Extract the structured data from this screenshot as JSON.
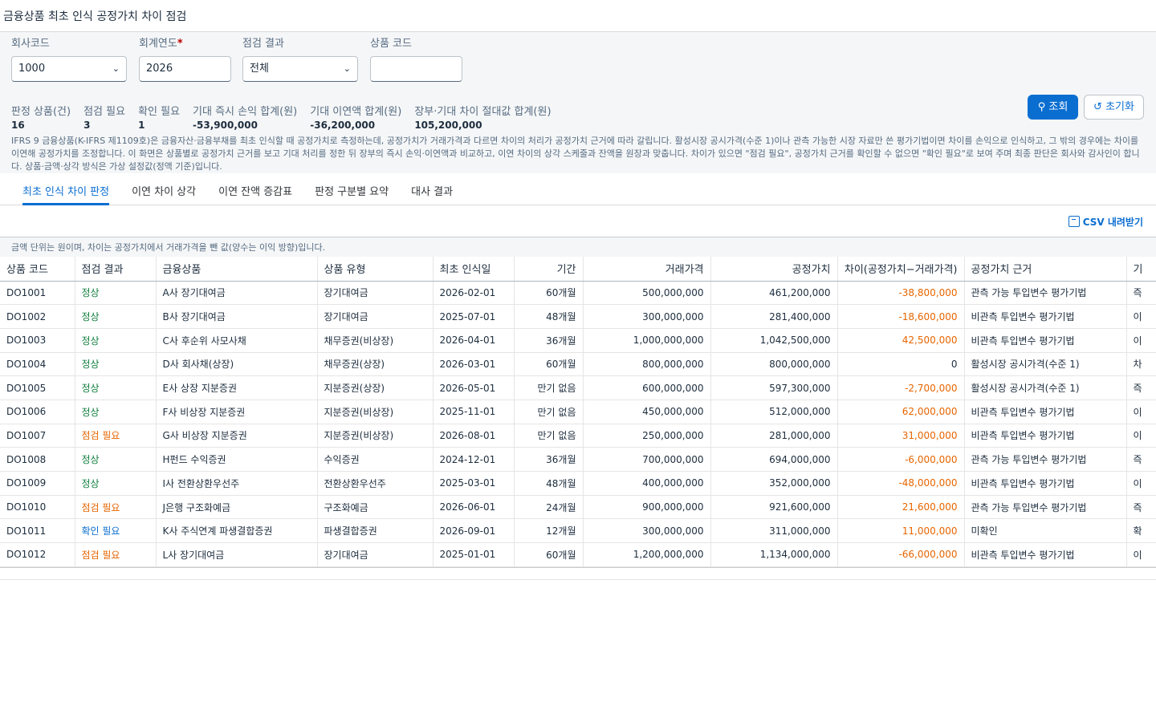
{
  "page": {
    "title": "금융상품 최초 인식 공정가치 차이 점검"
  },
  "filters": {
    "company": {
      "label": "회사코드",
      "value": "1000"
    },
    "year": {
      "label": "회계연도",
      "required_mark": "*",
      "value": "2026"
    },
    "result": {
      "label": "점검 결과",
      "value": "전체"
    },
    "product": {
      "label": "상품 코드",
      "value": ""
    },
    "search_label": "조회",
    "reset_label": "초기화"
  },
  "kpis": [
    {
      "label": "판정 상품(건)",
      "value": "16"
    },
    {
      "label": "점검 필요",
      "value": "3"
    },
    {
      "label": "확인 필요",
      "value": "1"
    },
    {
      "label": "기대 즉시 손익 합계(원)",
      "value": "-53,900,000"
    },
    {
      "label": "기대 이연액 합계(원)",
      "value": "-36,200,000"
    },
    {
      "label": "장부·기대 차이 절대값 합계(원)",
      "value": "105,200,000"
    }
  ],
  "description": "IFRS 9 금융상품(K-IFRS 제1109호)은 금융자산·금융부채를 최초 인식할 때 공정가치로 측정하는데, 공정가치가 거래가격과 다르면 차이의 처리가 공정가치 근거에 따라 갈립니다. 활성시장 공시가격(수준 1)이나 관측 가능한 시장 자료만 쓴 평가기법이면 차이를 손익으로 인식하고, 그 밖의 경우에는 차이를 이연해 공정가치를 조정합니다. 이 화면은 상품별로 공정가치 근거를 보고 기대 처리를 정한 뒤 장부의 즉시 손익·이연액과 비교하고, 이연 차이의 상각 스케줄과 잔액을 원장과 맞춥니다. 차이가 있으면 \"점검 필요\", 공정가치 근거를 확인할 수 없으면 \"확인 필요\"로 보여 주며 최종 판단은 회사와 감사인이 합니다. 상품·금액·상각 방식은 가상 설정값(정액 기준)입니다.",
  "tabs": [
    "최초 인식 차이 판정",
    "이연 차이 상각",
    "이연 잔액 증감표",
    "판정 구분별 요약",
    "대사 결과"
  ],
  "csv_label": "CSV 내려받기",
  "unit_note": "금액 단위는 원이며, 차이는 공정가치에서 거래가격을 뺀 값(양수는 이익 방향)입니다.",
  "table": {
    "headers": [
      "상품 코드",
      "점검 결과",
      "금융상품",
      "상품 유형",
      "최초 인식일",
      "기간",
      "거래가격",
      "공정가치",
      "차이(공정가치−거래가격)",
      "공정가치 근거",
      "기"
    ],
    "rows": [
      [
        "DO1001",
        "정상",
        "A사 장기대여금",
        "장기대여금",
        "2026-02-01",
        "60개월",
        "500,000,000",
        "461,200,000",
        "-38,800,000",
        "관측 가능 투입변수 평가기법",
        "즉"
      ],
      [
        "DO1002",
        "정상",
        "B사 장기대여금",
        "장기대여금",
        "2025-07-01",
        "48개월",
        "300,000,000",
        "281,400,000",
        "-18,600,000",
        "비관측 투입변수 평가기법",
        "이"
      ],
      [
        "DO1003",
        "정상",
        "C사 후순위 사모사채",
        "채무증권(비상장)",
        "2026-04-01",
        "36개월",
        "1,000,000,000",
        "1,042,500,000",
        "42,500,000",
        "비관측 투입변수 평가기법",
        "이"
      ],
      [
        "DO1004",
        "정상",
        "D사 회사채(상장)",
        "채무증권(상장)",
        "2026-03-01",
        "60개월",
        "800,000,000",
        "800,000,000",
        "0",
        "활성시장 공시가격(수준 1)",
        "차"
      ],
      [
        "DO1005",
        "정상",
        "E사 상장 지분증권",
        "지분증권(상장)",
        "2026-05-01",
        "만기 없음",
        "600,000,000",
        "597,300,000",
        "-2,700,000",
        "활성시장 공시가격(수준 1)",
        "즉"
      ],
      [
        "DO1006",
        "정상",
        "F사 비상장 지분증권",
        "지분증권(비상장)",
        "2025-11-01",
        "만기 없음",
        "450,000,000",
        "512,000,000",
        "62,000,000",
        "비관측 투입변수 평가기법",
        "이"
      ],
      [
        "DO1007",
        "점검 필요",
        "G사 비상장 지분증권",
        "지분증권(비상장)",
        "2026-08-01",
        "만기 없음",
        "250,000,000",
        "281,000,000",
        "31,000,000",
        "비관측 투입변수 평가기법",
        "이"
      ],
      [
        "DO1008",
        "정상",
        "H펀드 수익증권",
        "수익증권",
        "2024-12-01",
        "36개월",
        "700,000,000",
        "694,000,000",
        "-6,000,000",
        "관측 가능 투입변수 평가기법",
        "즉"
      ],
      [
        "DO1009",
        "정상",
        "I사 전환상환우선주",
        "전환상환우선주",
        "2025-03-01",
        "48개월",
        "400,000,000",
        "352,000,000",
        "-48,000,000",
        "비관측 투입변수 평가기법",
        "이"
      ],
      [
        "DO1010",
        "점검 필요",
        "J은행 구조화예금",
        "구조화예금",
        "2026-06-01",
        "24개월",
        "900,000,000",
        "921,600,000",
        "21,600,000",
        "관측 가능 투입변수 평가기법",
        "즉"
      ],
      [
        "DO1011",
        "확인 필요",
        "K사 주식연계 파생결합증권",
        "파생결합증권",
        "2026-09-01",
        "12개월",
        "300,000,000",
        "311,000,000",
        "11,000,000",
        "미확인",
        "확"
      ],
      [
        "DO1012",
        "점검 필요",
        "L사 장기대여금",
        "장기대여금",
        "2025-01-01",
        "60개월",
        "1,200,000,000",
        "1,134,000,000",
        "-66,000,000",
        "비관측 투입변수 평가기법",
        "이"
      ]
    ]
  },
  "colors": {
    "accent": "#0a6ed1",
    "ok": "#107e3e",
    "warning": "#e76500"
  }
}
